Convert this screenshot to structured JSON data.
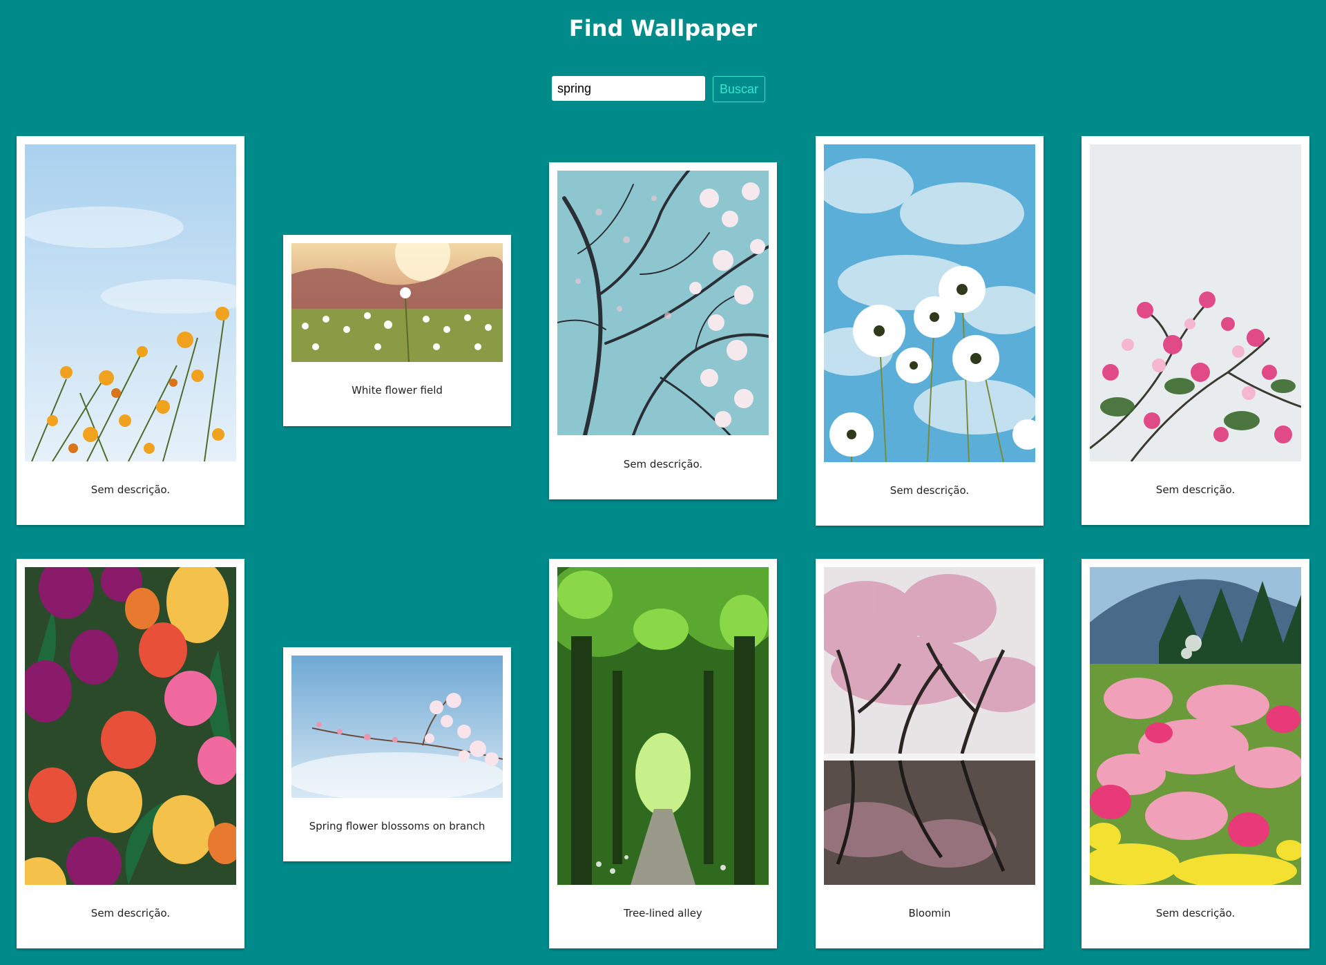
{
  "header": {
    "title": "Find Wallpaper"
  },
  "search": {
    "value": "spring",
    "button_label": "Buscar"
  },
  "wallpapers": [
    {
      "caption": "Sem descrição.",
      "subject": "orange wildflowers against pale sky"
    },
    {
      "caption": "White flower field",
      "subject": "sunlit white flower meadow"
    },
    {
      "caption": "Sem descrição.",
      "subject": "magnolia tree branches against blue sky"
    },
    {
      "caption": "Sem descrição.",
      "subject": "white cosmos flowers against clouds"
    },
    {
      "caption": "Sem descrição.",
      "subject": "pink crabapple blossoms on white"
    },
    {
      "caption": "Sem descrição.",
      "subject": "colorful tulip bouquet"
    },
    {
      "caption": "Spring flower blossoms on branch",
      "subject": "cherry blossom branch against blue sky"
    },
    {
      "caption": "Tree-lined alley",
      "subject": "green tree tunnel with path"
    },
    {
      "caption": "Bloomin",
      "subject": "cherry trees reflected in water"
    },
    {
      "caption": "Sem descrição.",
      "subject": "pink blossom orchard on mountain hillside"
    }
  ],
  "colors": {
    "background": "#008b8b",
    "accent": "#35e6d2",
    "card": "#ffffff"
  }
}
